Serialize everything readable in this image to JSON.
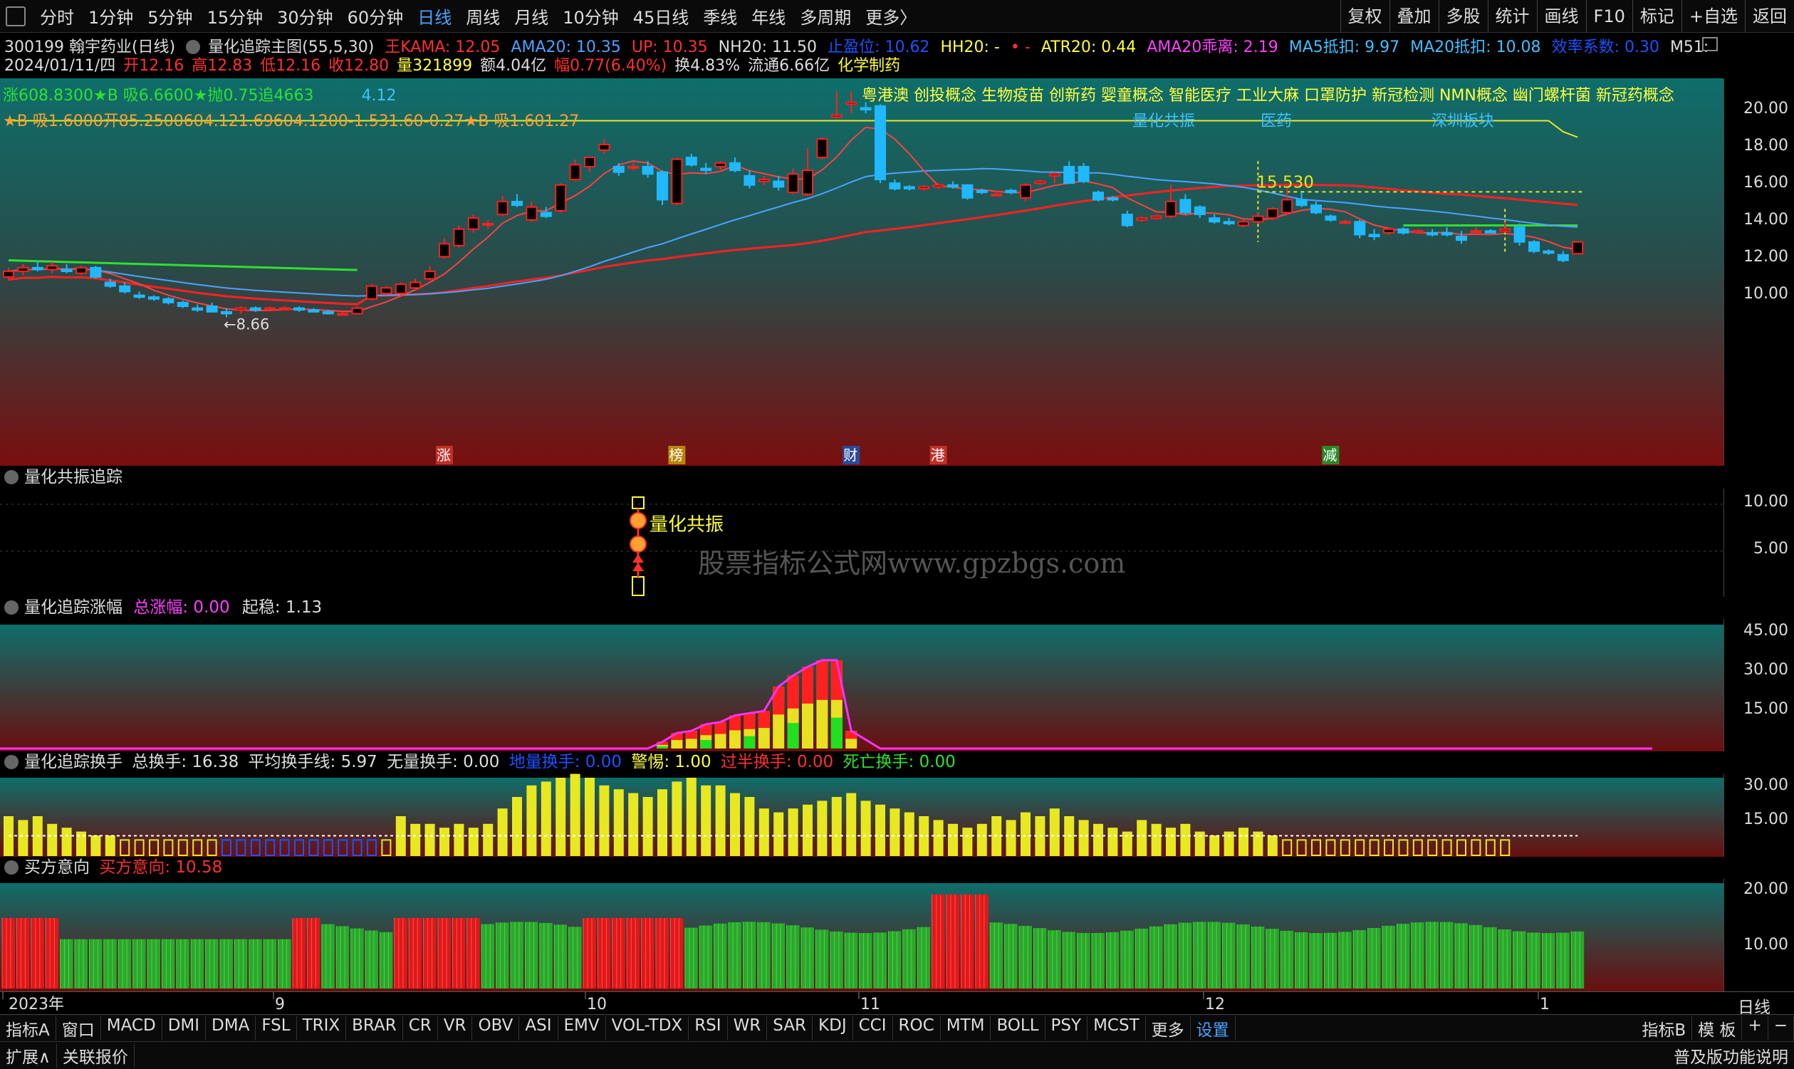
{
  "periods": [
    "分时",
    "1分钟",
    "5分钟",
    "15分钟",
    "30分钟",
    "60分钟",
    "日线",
    "周线",
    "月线",
    "10分钟",
    "45日线",
    "季线",
    "年线",
    "多周期",
    "更多〉"
  ],
  "active_period": "日线",
  "right_buttons": [
    "复权",
    "叠加",
    "多股",
    "统计",
    "画线",
    "F10",
    "标记",
    "+自选",
    "返回"
  ],
  "header": {
    "code_name": "300199 翰宇药业(日线)",
    "indicator_name": "量化追踪主图(55,5,30)",
    "kama": "王KAMA: 12.05",
    "ama20": "AMA20: 10.35",
    "up": "UP: 10.35",
    "nh20": "NH20: 11.50",
    "stop": "止盈位: 10.62",
    "hh20": "HH20: -",
    "marker": "• -",
    "atr20": "ATR20: 0.44",
    "ama20_dev": "AMA20乖离: 2.19",
    "ma5": "MA5抵扣: 9.97",
    "ma20": "MA20抵扣: 10.08",
    "eff": "效率系数: 0.30",
    "m51": "M51:"
  },
  "date_line": {
    "date": "2024/01/11/四",
    "open": "开12.16",
    "high": "高12.83",
    "low": "低12.16",
    "close": "收12.80",
    "vol": "量321899",
    "amt": "额4.04亿",
    "chg": "幅0.77(6.40%)",
    "turn": "换4.83%",
    "float": "流通6.66亿",
    "sector": "化学制药"
  },
  "line3": "涨608.8300★B 吸6.6600★抛0.75追4663",
  "line3b": "4.12",
  "line4": "★B 吸1.6000开85.2500604.121.69604.1200-1.531.60-0.27★B 吸1.601.27",
  "concepts": "粤港澳 创投概念 生物疫苗 创新药 婴童概念 智能医疗 工业大麻 口罩防护 新冠检测 NMN概念 幽门螺杆菌 新冠药概念",
  "concepts2": [
    "量化共振",
    "医药",
    "深圳板块"
  ],
  "main_axis": [
    "20.00",
    "18.00",
    "16.00",
    "14.00",
    "12.00",
    "10.00"
  ],
  "low_label": "←8.66",
  "high_label": "15.530",
  "events": [
    {
      "t": "涨",
      "color": "#c0302a"
    },
    {
      "t": "榜",
      "color": "#b8860b"
    },
    {
      "t": "财",
      "color": "#2a4a9a"
    },
    {
      "t": "港",
      "color": "#c0302a"
    },
    {
      "t": "减",
      "color": "#2a8a2a"
    }
  ],
  "panel2": {
    "title": "量化共振追踪",
    "label": "量化共振",
    "axis": [
      "10.00",
      "5.00"
    ]
  },
  "panel3": {
    "title": "量化追踪涨幅",
    "total_label": "总涨幅:",
    "total": "0.00",
    "stable_label": "起稳:",
    "stable": "1.13",
    "axis": [
      "45.00",
      "30.00",
      "15.00"
    ]
  },
  "panel4": {
    "title": "量化追踪换手",
    "total": "总换手: 16.38",
    "avg": "平均换手线: 5.97",
    "none": "无量换手: 0.00",
    "low": "地量换手: 0.00",
    "warn": "警惕: 1.00",
    "half": "过半换手: 0.00",
    "dead": "死亡换手: 0.00",
    "axis": [
      "30.00",
      "15.00"
    ]
  },
  "panel5": {
    "title": "买方意向",
    "label": "买方意向:",
    "value": "10.58",
    "axis": [
      "20.00",
      "10.00"
    ]
  },
  "time_axis": [
    "2023年",
    "9",
    "10",
    "11",
    "12",
    "1"
  ],
  "time_right": "日线",
  "tabs": [
    "指标A",
    "窗口",
    "MACD",
    "DMI",
    "DMA",
    "FSL",
    "TRIX",
    "BRAR",
    "CR",
    "VR",
    "OBV",
    "ASI",
    "EMV",
    "VOL-TDX",
    "RSI",
    "WR",
    "SAR",
    "KDJ",
    "CCI",
    "ROC",
    "MTM",
    "BOLL",
    "PSY",
    "MCST",
    "更多",
    "设置"
  ],
  "active_tab": "设置",
  "tabs_right": [
    "指标B",
    "模 板",
    "+",
    "−"
  ],
  "status_left": [
    "扩展∧",
    "关联报价"
  ],
  "status_right": "普及版功能说明",
  "watermark": "股票指标公式网www.gpzbgs.com",
  "chart_data": {
    "type": "candlestick",
    "ylim": [
      8,
      21
    ],
    "candles": [
      [
        10.9,
        11.4,
        10.7,
        11.2
      ],
      [
        11.2,
        11.6,
        11.0,
        11.4
      ],
      [
        11.4,
        11.8,
        11.2,
        11.3
      ],
      [
        11.3,
        11.7,
        11.1,
        11.5
      ],
      [
        11.3,
        11.6,
        11.1,
        11.2
      ],
      [
        11.1,
        11.5,
        11.0,
        11.4
      ],
      [
        11.4,
        11.5,
        10.8,
        10.9
      ],
      [
        10.6,
        10.8,
        10.3,
        10.4
      ],
      [
        10.4,
        10.6,
        10.0,
        10.1
      ],
      [
        9.9,
        10.1,
        9.7,
        9.8
      ],
      [
        9.8,
        9.9,
        9.6,
        9.7
      ],
      [
        9.7,
        9.8,
        9.4,
        9.5
      ],
      [
        9.5,
        9.6,
        9.2,
        9.3
      ],
      [
        9.2,
        9.4,
        9.0,
        9.1
      ],
      [
        9.3,
        9.5,
        9.0,
        9.0
      ],
      [
        9.0,
        9.2,
        8.7,
        8.9
      ],
      [
        9.1,
        9.3,
        8.9,
        9.2
      ],
      [
        9.2,
        9.3,
        9.0,
        9.1
      ],
      [
        9.2,
        9.3,
        9.1,
        9.2
      ],
      [
        9.2,
        9.3,
        9.1,
        9.2
      ],
      [
        9.2,
        9.3,
        9.0,
        9.1
      ],
      [
        9.1,
        9.2,
        9.0,
        9.0
      ],
      [
        9.0,
        9.1,
        8.9,
        8.9
      ],
      [
        8.9,
        9.0,
        8.8,
        8.9
      ],
      [
        8.9,
        9.3,
        8.9,
        9.2
      ],
      [
        9.7,
        10.5,
        9.6,
        10.4
      ],
      [
        10.0,
        10.4,
        9.9,
        10.3
      ],
      [
        10.0,
        10.6,
        9.9,
        10.5
      ],
      [
        10.3,
        10.8,
        10.2,
        10.6
      ],
      [
        10.8,
        11.5,
        10.7,
        11.2
      ],
      [
        12.0,
        13.0,
        11.9,
        12.7
      ],
      [
        12.6,
        13.7,
        12.5,
        13.5
      ],
      [
        13.5,
        14.3,
        13.3,
        14.1
      ],
      [
        13.8,
        14.0,
        13.5,
        13.8
      ],
      [
        14.3,
        15.3,
        14.2,
        15.0
      ],
      [
        15.0,
        15.4,
        14.7,
        14.8
      ],
      [
        14.0,
        15.0,
        13.9,
        14.7
      ],
      [
        14.4,
        14.7,
        14.1,
        14.2
      ],
      [
        14.5,
        16.0,
        14.4,
        15.9
      ],
      [
        16.2,
        17.3,
        16.1,
        17.0
      ],
      [
        16.9,
        17.4,
        16.6,
        17.4
      ],
      [
        17.8,
        18.4,
        17.6,
        18.1
      ],
      [
        16.9,
        17.1,
        16.4,
        16.6
      ],
      [
        16.9,
        17.1,
        16.7,
        16.9
      ],
      [
        16.9,
        17.2,
        16.3,
        16.5
      ],
      [
        16.6,
        16.7,
        14.8,
        15.1
      ],
      [
        14.9,
        17.4,
        14.8,
        17.3
      ],
      [
        17.4,
        17.6,
        16.9,
        17.0
      ],
      [
        16.8,
        17.1,
        16.5,
        16.7
      ],
      [
        16.9,
        17.2,
        16.6,
        17.1
      ],
      [
        17.1,
        17.4,
        16.6,
        16.7
      ],
      [
        16.4,
        16.7,
        15.7,
        15.9
      ],
      [
        16.1,
        16.4,
        15.9,
        16.2
      ],
      [
        16.1,
        16.4,
        15.6,
        15.8
      ],
      [
        15.5,
        16.8,
        15.4,
        16.5
      ],
      [
        15.4,
        17.9,
        15.3,
        16.7
      ],
      [
        17.4,
        18.5,
        17.3,
        18.4
      ],
      [
        19.6,
        21.0,
        19.5,
        19.7
      ],
      [
        20.3,
        21.0,
        19.8,
        20.4
      ],
      [
        20.1,
        20.4,
        19.8,
        20.0
      ],
      [
        20.2,
        20.3,
        16.0,
        16.2
      ],
      [
        16.0,
        16.2,
        15.6,
        15.7
      ],
      [
        15.8,
        15.9,
        15.6,
        15.7
      ],
      [
        15.7,
        15.9,
        15.6,
        15.8
      ],
      [
        15.8,
        16.0,
        15.7,
        15.9
      ],
      [
        15.9,
        16.1,
        15.7,
        15.8
      ],
      [
        15.9,
        15.9,
        15.1,
        15.2
      ],
      [
        15.6,
        15.7,
        15.4,
        15.5
      ],
      [
        15.4,
        15.6,
        15.3,
        15.4
      ],
      [
        15.6,
        15.7,
        15.4,
        15.5
      ],
      [
        15.2,
        16.0,
        15.0,
        15.9
      ],
      [
        16.0,
        16.2,
        15.9,
        16.1
      ],
      [
        16.4,
        16.6,
        16.0,
        16.5
      ],
      [
        16.9,
        17.2,
        16.0,
        16.0
      ],
      [
        16.9,
        17.1,
        16.0,
        16.1
      ],
      [
        15.5,
        15.6,
        15.0,
        15.1
      ],
      [
        15.2,
        15.3,
        15.0,
        15.1
      ],
      [
        14.3,
        14.5,
        13.6,
        13.7
      ],
      [
        14.0,
        14.2,
        13.9,
        14.1
      ],
      [
        14.1,
        14.3,
        14.0,
        14.2
      ],
      [
        14.2,
        15.9,
        14.1,
        15.0
      ],
      [
        15.1,
        15.4,
        14.3,
        14.4
      ],
      [
        14.7,
        14.8,
        14.1,
        14.3
      ],
      [
        14.1,
        14.3,
        13.8,
        13.9
      ],
      [
        13.9,
        14.1,
        13.7,
        13.8
      ],
      [
        13.7,
        14.0,
        13.6,
        13.9
      ],
      [
        13.9,
        14.4,
        13.8,
        14.2
      ],
      [
        14.1,
        14.7,
        14.0,
        14.6
      ],
      [
        14.4,
        15.7,
        14.3,
        15.1
      ],
      [
        15.1,
        15.5,
        14.7,
        14.8
      ],
      [
        14.8,
        15.0,
        14.3,
        14.4
      ],
      [
        14.2,
        14.3,
        13.9,
        14.0
      ],
      [
        13.9,
        14.0,
        13.8,
        13.9
      ],
      [
        13.9,
        14.0,
        13.0,
        13.2
      ],
      [
        13.2,
        13.5,
        12.9,
        13.1
      ],
      [
        13.3,
        13.6,
        13.2,
        13.5
      ],
      [
        13.5,
        13.6,
        13.2,
        13.3
      ],
      [
        13.4,
        13.5,
        13.3,
        13.4
      ],
      [
        13.3,
        13.5,
        13.1,
        13.2
      ],
      [
        13.3,
        13.6,
        13.1,
        13.2
      ],
      [
        13.1,
        13.4,
        12.7,
        12.9
      ],
      [
        13.4,
        13.6,
        13.2,
        13.4
      ],
      [
        13.4,
        13.5,
        13.3,
        13.3
      ],
      [
        13.4,
        13.9,
        13.3,
        13.5
      ],
      [
        13.6,
        13.8,
        12.6,
        12.8
      ],
      [
        12.8,
        12.9,
        12.2,
        12.3
      ],
      [
        12.3,
        12.4,
        12.1,
        12.2
      ],
      [
        12.1,
        12.3,
        11.7,
        11.8
      ],
      [
        12.16,
        12.83,
        12.16,
        12.8
      ]
    ]
  }
}
